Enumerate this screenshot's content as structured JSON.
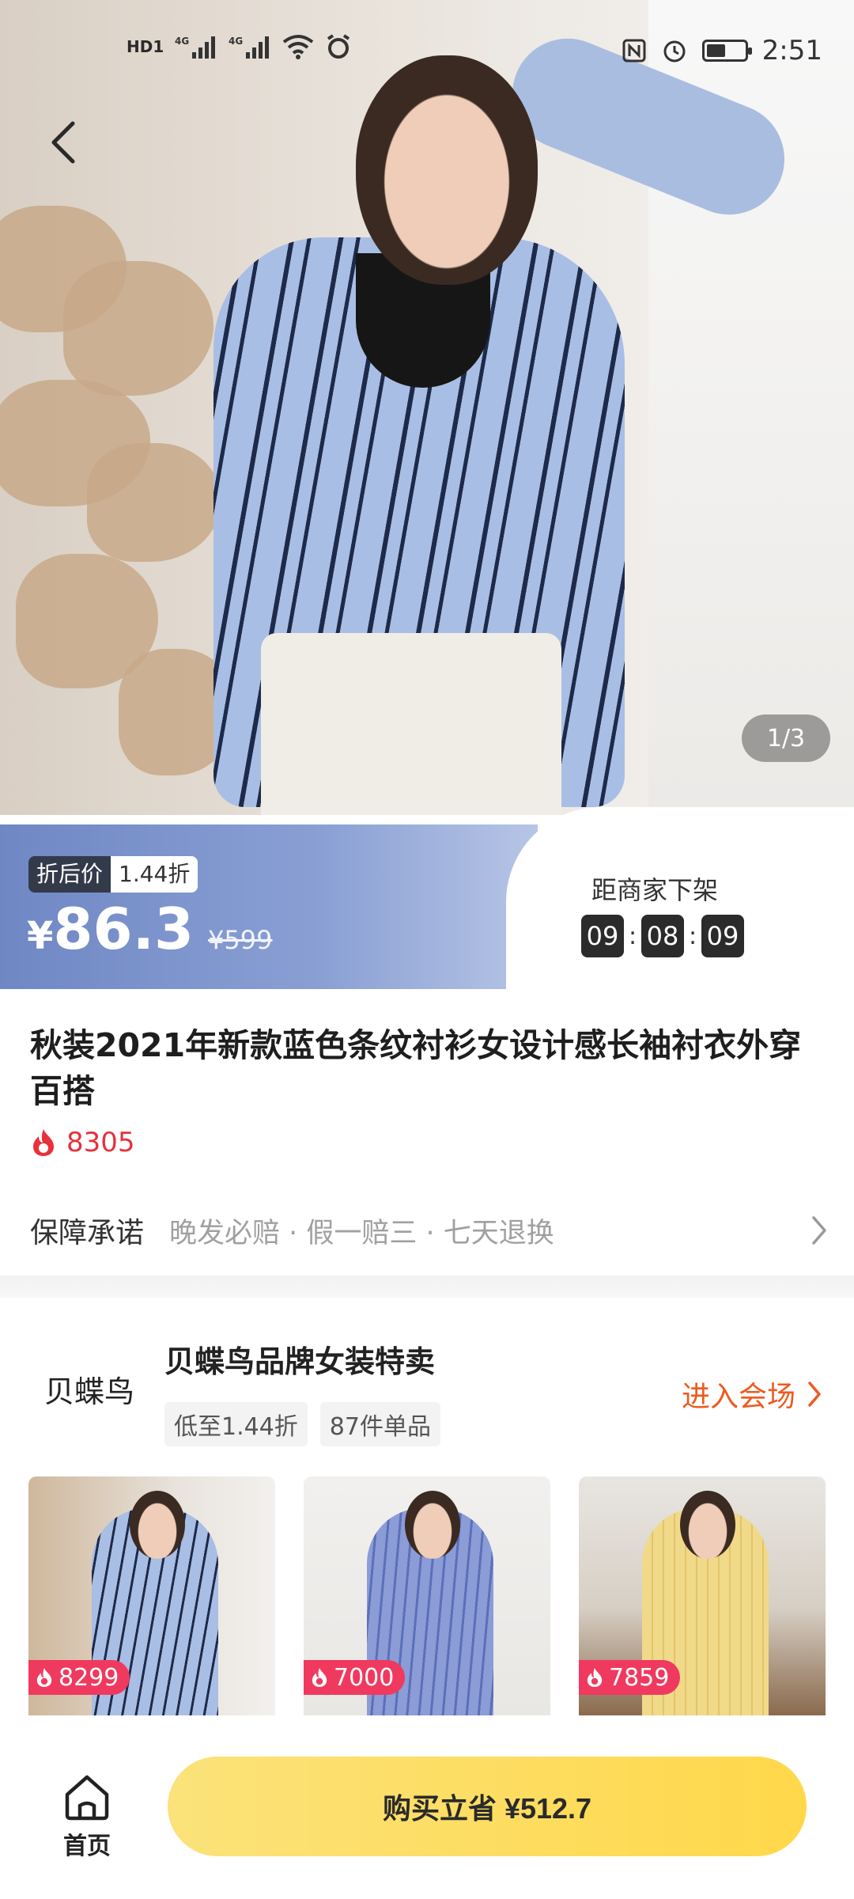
{
  "statusbar": {
    "left_labels": [
      "HD1",
      "4G",
      "4G"
    ],
    "time": "2:51",
    "battery_level": 0.5
  },
  "hero": {
    "image_counter": "1/3"
  },
  "price": {
    "tag_label": "折后价",
    "discount": "1.44折",
    "currency": "¥",
    "current": "86.3",
    "original": "¥599",
    "countdown_title": "距商家下架",
    "countdown": [
      "09",
      "08",
      "09"
    ]
  },
  "product": {
    "title": "秋装2021年新款蓝色条纹衬衫女设计感长袖衬衣外穿百搭",
    "heat": "8305",
    "guarantee_label": "保障承诺",
    "guarantee_items": "晚发必赔 · 假一赔三 · 七天退换"
  },
  "store": {
    "logo_text": "贝蝶鸟",
    "name": "贝蝶鸟品牌女装特卖",
    "tags": [
      "低至1.44折",
      "87件单品"
    ],
    "enter_label": "进入会场",
    "items": [
      {
        "heat": "8299",
        "color": "#a9bee4"
      },
      {
        "heat": "7000",
        "color": "#8b9cd6"
      },
      {
        "heat": "7859",
        "color": "#f1d98a"
      }
    ]
  },
  "bottom": {
    "home_label": "首页",
    "buy_label": "购买立省 ¥512.7"
  },
  "colors": {
    "accent_orange": "#ee5a1e",
    "heat_red": "#e8303c",
    "buy_yellow": "#ffd84a",
    "price_blue": "#7b91cc"
  }
}
